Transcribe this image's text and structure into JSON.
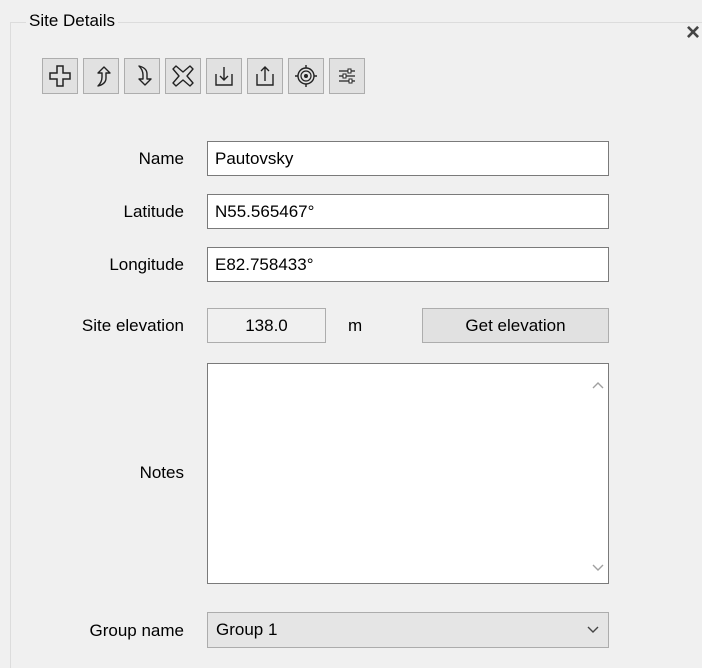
{
  "panel": {
    "title": "Site Details",
    "close_symbol": "×"
  },
  "toolbar": {
    "buttons": [
      {
        "icon": "add-icon"
      },
      {
        "icon": "move-up-icon"
      },
      {
        "icon": "move-down-icon"
      },
      {
        "icon": "delete-icon"
      },
      {
        "icon": "import-icon"
      },
      {
        "icon": "export-icon"
      },
      {
        "icon": "target-icon"
      },
      {
        "icon": "settings-sliders-icon"
      }
    ]
  },
  "form": {
    "name_label": "Name",
    "name_value": "Pautovsky",
    "latitude_label": "Latitude",
    "latitude_value": "N55.565467°",
    "longitude_label": "Longitude",
    "longitude_value": "E82.758433°",
    "elevation_label": "Site elevation",
    "elevation_value": "138.0",
    "elevation_unit": "m",
    "get_elevation_label": "Get elevation",
    "notes_label": "Notes",
    "notes_value": "",
    "group_label": "Group name",
    "group_value": "Group 1"
  }
}
